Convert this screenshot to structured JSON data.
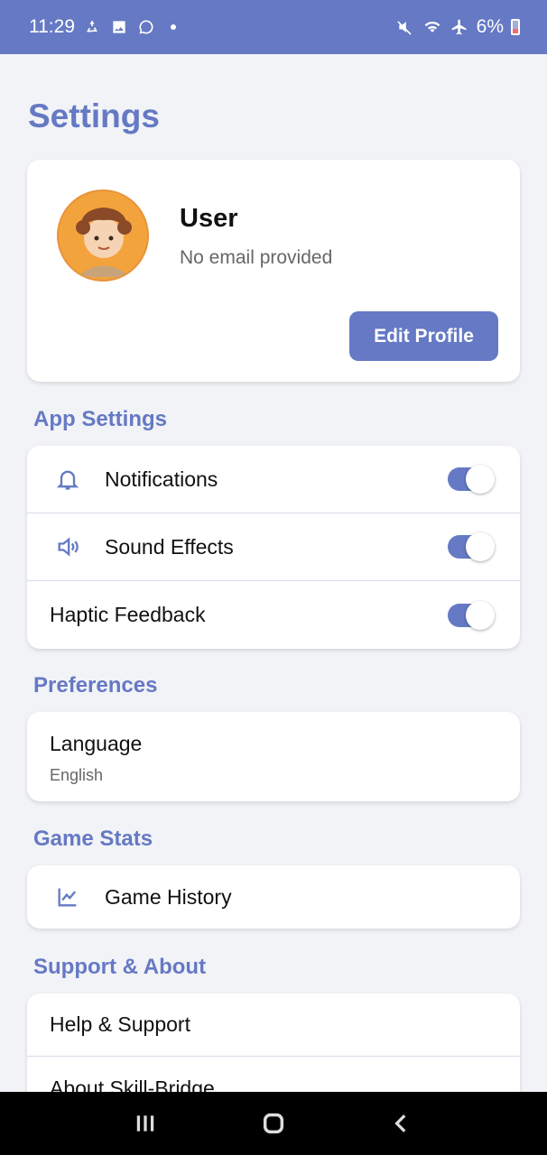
{
  "status_bar": {
    "time": "11:29",
    "battery": "6%",
    "left_icons": [
      "recycle-icon",
      "image-icon",
      "whatsapp-icon"
    ],
    "right_icons": [
      "mute-icon",
      "wifi-icon",
      "airplane-icon",
      "battery-icon"
    ]
  },
  "page": {
    "title": "Settings"
  },
  "profile": {
    "name": "User",
    "email": "No email provided",
    "edit_label": "Edit Profile"
  },
  "app_settings": {
    "title": "App Settings",
    "items": [
      {
        "label": "Notifications",
        "icon": "bell-icon",
        "enabled": true
      },
      {
        "label": "Sound Effects",
        "icon": "speaker-icon",
        "enabled": true
      },
      {
        "label": "Haptic Feedback",
        "icon": "",
        "enabled": true
      }
    ]
  },
  "preferences": {
    "title": "Preferences",
    "language_label": "Language",
    "language_value": "English"
  },
  "game_stats": {
    "title": "Game Stats",
    "items": [
      {
        "label": "Game History",
        "icon": "chart-icon"
      }
    ]
  },
  "support": {
    "title": "Support & About",
    "items": [
      {
        "label": "Help & Support"
      },
      {
        "label": "About Skill-Bridge"
      }
    ]
  },
  "colors": {
    "accent": "#6579c4",
    "background": "#f2f3f7"
  }
}
